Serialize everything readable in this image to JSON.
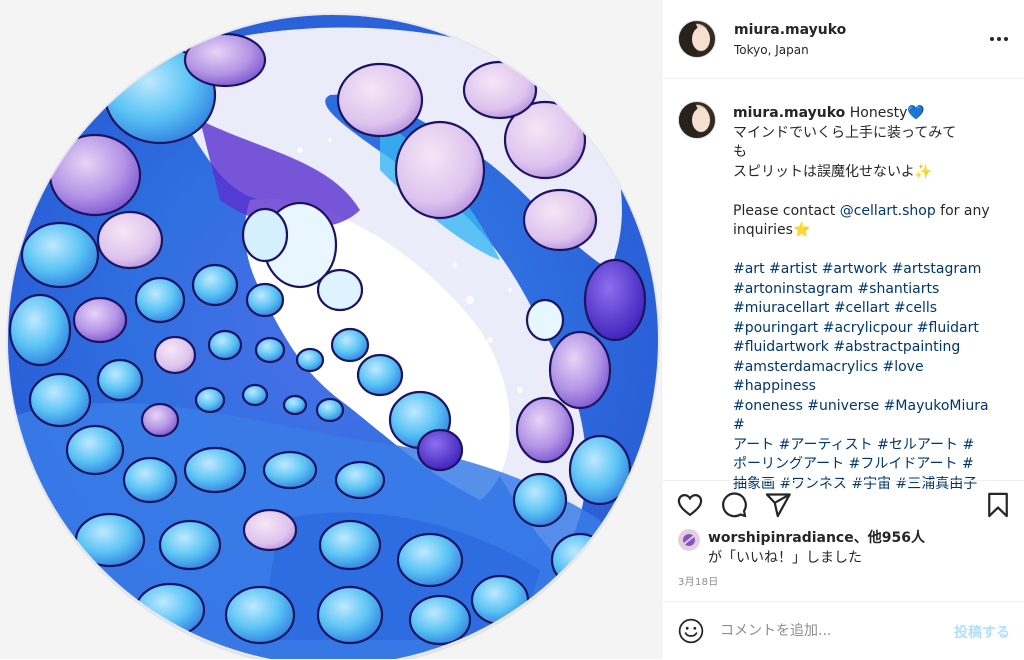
{
  "header": {
    "username": "miura.mayuko",
    "location": "Tokyo, Japan",
    "more_icon": "more-horizontal-icon"
  },
  "caption": {
    "username": "miura.mayuko",
    "line1": "Honesty💙",
    "line2": "マインドでいくら上手に装ってみて",
    "line3": "も",
    "line4": "スピリットは誤魔化せないよ✨",
    "contact_prefix": "Please contact ",
    "contact_link": "@cellart.shop",
    "contact_suffix": " for any",
    "contact_line2": "inquiries⭐",
    "hashtag_lines": [
      "#art #artist #artwork #artstagram",
      "#artoninstagram #shantiarts",
      "#miuracellart #cellart #cells",
      "#pouringart #acrylicpour #fluidart",
      "#fluidartwork #abstractpainting",
      "#amsterdamacrylics #love #happiness",
      "#oneness #universe #MayukoMiura #",
      "アート #アーティスト #セルアート #",
      "ポーリングアート #フルイドアート #",
      "抽象画 #ワンネス #宇宙 #三浦真由子"
    ]
  },
  "actions": {
    "like_icon": "heart-icon",
    "comment_icon": "comment-icon",
    "share_icon": "share-icon",
    "save_icon": "bookmark-icon"
  },
  "likes": {
    "line1": "worshipinradiance、他956人",
    "line2": "が「いいね！」しました"
  },
  "date": "3月18日",
  "comment": {
    "placeholder": "コメントを追加...",
    "post_label": "投稿する",
    "emoji_icon": "smiley-icon"
  },
  "colors": {
    "text": "#262626",
    "link": "#00376b",
    "muted": "#8e8e8e",
    "post_disabled": "#b2dffc",
    "border": "#efefef"
  }
}
